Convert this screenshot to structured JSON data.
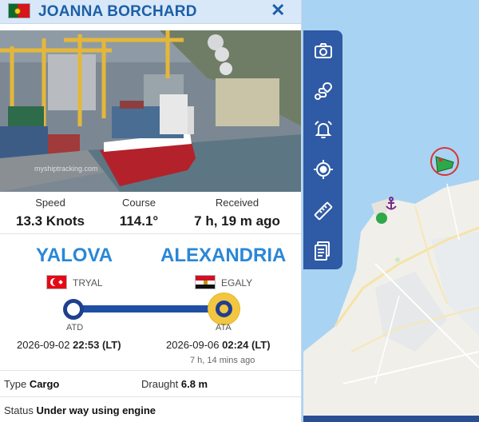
{
  "vessel": {
    "name": "JOANNA BORCHARD",
    "flag": "portugal-flag"
  },
  "photo": {
    "watermark": "myshiptracking.com"
  },
  "stats": {
    "speed_label": "Speed",
    "speed_value": "13.3 Knots",
    "course_label": "Course",
    "course_value": "114.1°",
    "received_label": "Received",
    "received_value": "7 h, 19 m ago"
  },
  "route": {
    "departure": {
      "port": "YALOVA",
      "code": "TRYAL",
      "flag": "turkey-flag",
      "label": "ATD",
      "date": "2026-09-02",
      "time": "22:53",
      "tz": "(LT)"
    },
    "arrival": {
      "port": "ALEXANDRIA",
      "code": "EGALY",
      "flag": "egypt-flag",
      "label": "ATA",
      "date": "2026-09-06",
      "time": "02:24",
      "tz": "(LT)",
      "ago": "7 h, 14 mins ago"
    }
  },
  "details": {
    "type_label": "Type",
    "type_value": "Cargo",
    "draught_label": "Draught",
    "draught_value": "6.8 m",
    "status_label": "Status",
    "status_value": "Under way using engine"
  },
  "toolbar": {
    "items": [
      "camera-icon",
      "route-icon",
      "alarm-bell-icon",
      "crosshair-icon",
      "ruler-icon",
      "documents-icon"
    ]
  },
  "colors": {
    "accent": "#2a87d6",
    "toolbar": "#2f5aa5",
    "track": "#1f4fa3",
    "arrival": "#f3c641",
    "sea": "#a9d3f2"
  }
}
